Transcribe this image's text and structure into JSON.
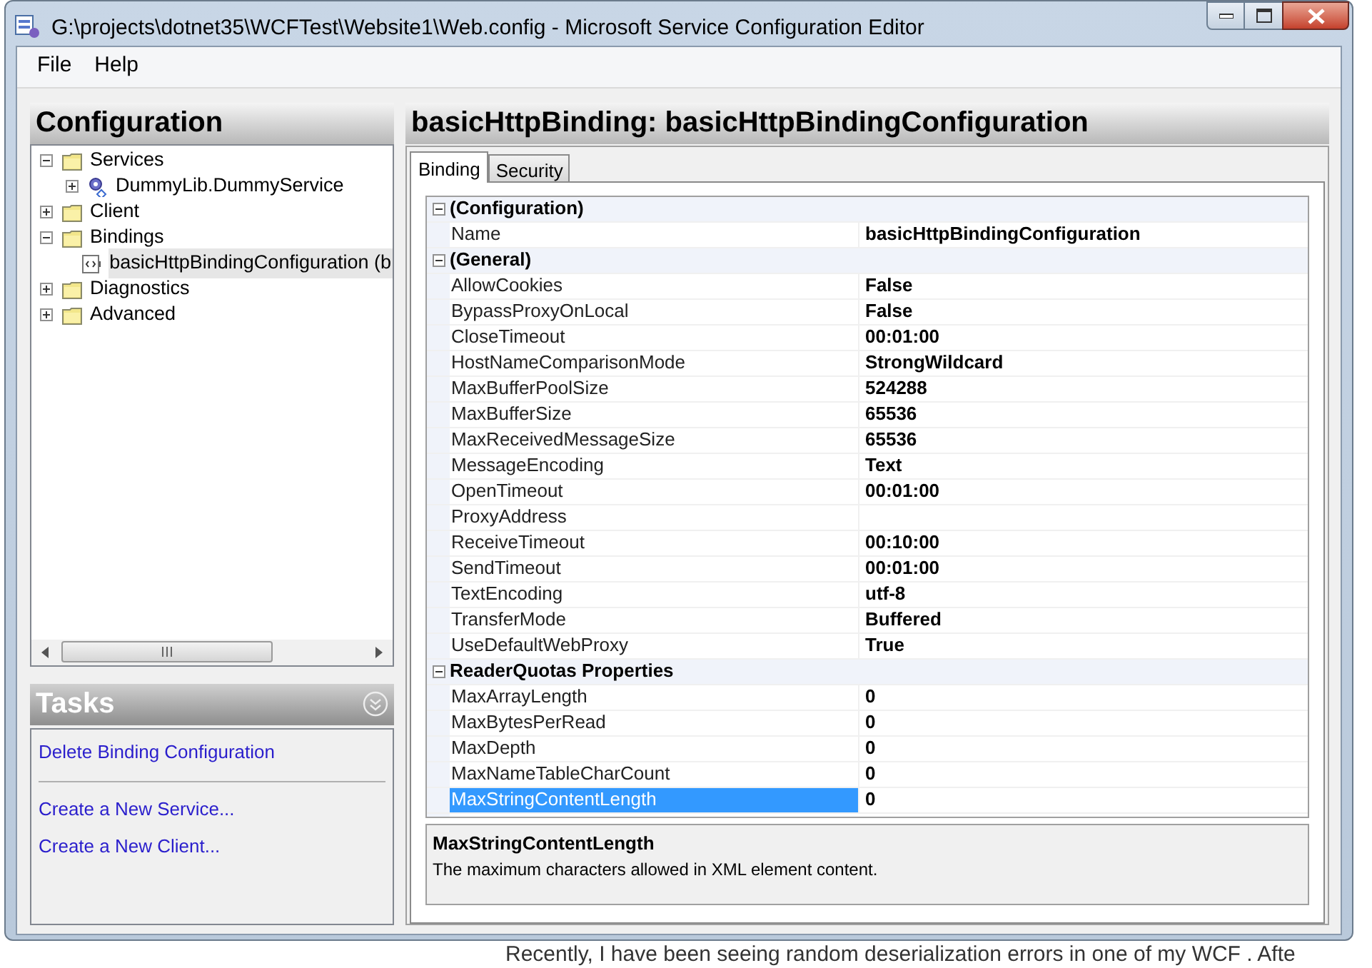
{
  "background_text": "Recently, I have been seeing random deserialization errors in one of my WCF . Afte",
  "window": {
    "title": "G:\\projects\\dotnet35\\WCFTest\\Website1\\Web.config - Microsoft Service Configuration Editor"
  },
  "menu": [
    "File",
    "Help"
  ],
  "configuration": {
    "title": "Configuration",
    "tree": [
      {
        "label": "Services",
        "kind": "folder",
        "expanded": true,
        "selected": false,
        "children": [
          {
            "label": "DummyLib.DummyService",
            "kind": "service",
            "expanded": false,
            "selected": false
          }
        ]
      },
      {
        "label": "Client",
        "kind": "folder",
        "expanded": false,
        "selected": false
      },
      {
        "label": "Bindings",
        "kind": "folder",
        "expanded": true,
        "selected": false,
        "children": [
          {
            "label": "basicHttpBindingConfiguration (b",
            "kind": "binding",
            "selected": true
          }
        ]
      },
      {
        "label": "Diagnostics",
        "kind": "folder",
        "expanded": false,
        "selected": false
      },
      {
        "label": "Advanced",
        "kind": "folder",
        "expanded": false,
        "selected": false
      }
    ]
  },
  "tasks": {
    "title": "Tasks",
    "groups": [
      [
        "Delete Binding Configuration"
      ],
      [
        "Create a New Service...",
        "Create a New Client..."
      ]
    ]
  },
  "editor": {
    "title": "basicHttpBinding: basicHttpBindingConfiguration",
    "tabs": [
      {
        "label": "Binding",
        "selected": true
      },
      {
        "label": "Security",
        "selected": false
      }
    ],
    "categories": [
      {
        "name": "(Configuration)",
        "expanded": true,
        "properties": [
          {
            "name": "Name",
            "value": "basicHttpBindingConfiguration",
            "selected": false
          }
        ]
      },
      {
        "name": "(General)",
        "expanded": true,
        "properties": [
          {
            "name": "AllowCookies",
            "value": "False",
            "selected": false
          },
          {
            "name": "BypassProxyOnLocal",
            "value": "False",
            "selected": false
          },
          {
            "name": "CloseTimeout",
            "value": "00:01:00",
            "selected": false
          },
          {
            "name": "HostNameComparisonMode",
            "value": "StrongWildcard",
            "selected": false
          },
          {
            "name": "MaxBufferPoolSize",
            "value": "524288",
            "selected": false
          },
          {
            "name": "MaxBufferSize",
            "value": "65536",
            "selected": false
          },
          {
            "name": "MaxReceivedMessageSize",
            "value": "65536",
            "selected": false
          },
          {
            "name": "MessageEncoding",
            "value": "Text",
            "selected": false
          },
          {
            "name": "OpenTimeout",
            "value": "00:01:00",
            "selected": false
          },
          {
            "name": "ProxyAddress",
            "selected": false
          },
          {
            "name": "ReceiveTimeout",
            "value": "00:10:00",
            "selected": false
          },
          {
            "name": "SendTimeout",
            "value": "00:01:00",
            "selected": false
          },
          {
            "name": "TextEncoding",
            "value": "utf-8",
            "selected": false
          },
          {
            "name": "TransferMode",
            "value": "Buffered",
            "selected": false
          },
          {
            "name": "UseDefaultWebProxy",
            "value": "True",
            "selected": false
          }
        ]
      },
      {
        "name": "ReaderQuotas Properties",
        "expanded": true,
        "properties": [
          {
            "name": "MaxArrayLength",
            "value": "0",
            "selected": false
          },
          {
            "name": "MaxBytesPerRead",
            "value": "0",
            "selected": false
          },
          {
            "name": "MaxDepth",
            "value": "0",
            "selected": false
          },
          {
            "name": "MaxNameTableCharCount",
            "value": "0",
            "selected": false
          },
          {
            "name": "MaxStringContentLength",
            "value": "0",
            "selected": true
          }
        ]
      }
    ],
    "description": {
      "title": "MaxStringContentLength",
      "text": "The maximum characters allowed in XML element content."
    }
  }
}
